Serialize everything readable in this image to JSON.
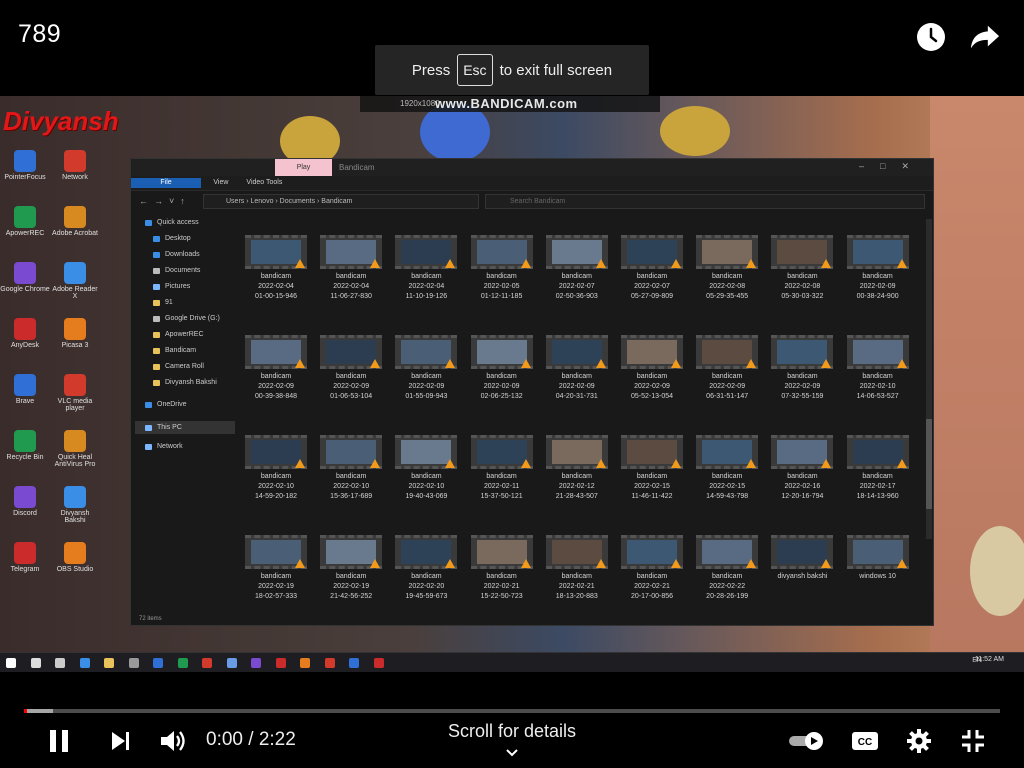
{
  "video_title": "789",
  "fullscreen_hint": {
    "prefix": "Press",
    "key": "Esc",
    "suffix": "to exit full screen"
  },
  "top_actions": [
    {
      "name": "watch-later-icon"
    },
    {
      "name": "share-icon"
    }
  ],
  "recording_overlay": {
    "watermark": "www.BANDICAM.com",
    "resolution": "1920x1080",
    "user_name": "Divyansh"
  },
  "desktop_icons": [
    "PointerFocus",
    "Network",
    "ApowerREC",
    "Adobe Acrobat",
    "Google Chrome",
    "Adobe Reader X",
    "AnyDesk",
    "Picasa 3",
    "Brave",
    "VLC media player",
    "Recycle Bin",
    "Quick Heal AntiVirus Pro",
    "Discord",
    "Divyansh Bakshi",
    "Telegram",
    "OBS Studio"
  ],
  "explorer": {
    "title": "Bandicam",
    "play_tab": "Play",
    "ribbon": [
      "File",
      "Home",
      "Share",
      "View",
      "Video Tools"
    ],
    "breadcrumb": "Users  ›  Lenovo  ›  Documents  ›  Bandicam",
    "search_placeholder": "Search Bandicam",
    "status": "72 items",
    "nav_items": [
      {
        "label": "Quick access",
        "color": "#3a8ee6"
      },
      {
        "label": "Desktop",
        "color": "#3a8ee6"
      },
      {
        "label": "Downloads",
        "color": "#3a8ee6"
      },
      {
        "label": "Documents",
        "color": "#bbbbbb"
      },
      {
        "label": "Pictures",
        "color": "#7ab7ff"
      },
      {
        "label": "91",
        "color": "#e8c25a"
      },
      {
        "label": "Google Drive (G:)",
        "color": "#bbbbbb"
      },
      {
        "label": "ApowerREC",
        "color": "#e8c25a"
      },
      {
        "label": "Bandicam",
        "color": "#e8c25a"
      },
      {
        "label": "Camera Roll",
        "color": "#e8c25a"
      },
      {
        "label": "Divyansh Bakshi",
        "color": "#e8c25a"
      },
      {
        "label": "OneDrive",
        "color": "#3a8ee6"
      },
      {
        "label": "This PC",
        "color": "#7ab7ff"
      },
      {
        "label": "Network",
        "color": "#7ab7ff"
      }
    ],
    "files": [
      {
        "name": "bandicam",
        "date": "2022-02-04",
        "time": "01-00-15-946"
      },
      {
        "name": "bandicam",
        "date": "2022-02-04",
        "time": "11-06-27-830"
      },
      {
        "name": "bandicam",
        "date": "2022-02-04",
        "time": "11-10-19-126"
      },
      {
        "name": "bandicam",
        "date": "2022-02-05",
        "time": "01-12-11-185"
      },
      {
        "name": "bandicam",
        "date": "2022-02-07",
        "time": "02-50-36-903"
      },
      {
        "name": "bandicam",
        "date": "2022-02-07",
        "time": "05-27-09-809"
      },
      {
        "name": "bandicam",
        "date": "2022-02-08",
        "time": "05-29-35-455"
      },
      {
        "name": "bandicam",
        "date": "2022-02-08",
        "time": "05-30-03-322"
      },
      {
        "name": "bandicam",
        "date": "2022-02-09",
        "time": "00-38-24-900"
      },
      {
        "name": "bandicam",
        "date": "2022-02-09",
        "time": "00-39-38-848"
      },
      {
        "name": "bandicam",
        "date": "2022-02-09",
        "time": "01-06-53-104"
      },
      {
        "name": "bandicam",
        "date": "2022-02-09",
        "time": "01-55-09-943"
      },
      {
        "name": "bandicam",
        "date": "2022-02-09",
        "time": "02-06-25-132"
      },
      {
        "name": "bandicam",
        "date": "2022-02-09",
        "time": "04-20-31-731"
      },
      {
        "name": "bandicam",
        "date": "2022-02-09",
        "time": "05-52-13-054"
      },
      {
        "name": "bandicam",
        "date": "2022-02-09",
        "time": "06-31-51-147"
      },
      {
        "name": "bandicam",
        "date": "2022-02-09",
        "time": "07-32-55-159"
      },
      {
        "name": "bandicam",
        "date": "2022-02-10",
        "time": "14-06-53-527"
      },
      {
        "name": "bandicam",
        "date": "2022-02-10",
        "time": "14-59-20-182"
      },
      {
        "name": "bandicam",
        "date": "2022-02-10",
        "time": "15-36-17-689"
      },
      {
        "name": "bandicam",
        "date": "2022-02-10",
        "time": "19-40-43-069"
      },
      {
        "name": "bandicam",
        "date": "2022-02-11",
        "time": "15-37-50-121"
      },
      {
        "name": "bandicam",
        "date": "2022-02-12",
        "time": "21-28-43-507"
      },
      {
        "name": "bandicam",
        "date": "2022-02-15",
        "time": "11-46-11-422"
      },
      {
        "name": "bandicam",
        "date": "2022-02-15",
        "time": "14-59-43-798"
      },
      {
        "name": "bandicam",
        "date": "2022-02-16",
        "time": "12-20-16-794"
      },
      {
        "name": "bandicam",
        "date": "2022-02-17",
        "time": "18-14-13-960"
      },
      {
        "name": "bandicam",
        "date": "2022-02-19",
        "time": "18-02-57-333"
      },
      {
        "name": "bandicam",
        "date": "2022-02-19",
        "time": "21-42-56-252"
      },
      {
        "name": "bandicam",
        "date": "2022-02-20",
        "time": "19-45-59-673"
      },
      {
        "name": "bandicam",
        "date": "2022-02-21",
        "time": "15-22-50-723"
      },
      {
        "name": "bandicam",
        "date": "2022-02-21",
        "time": "18-13-20-883"
      },
      {
        "name": "bandicam",
        "date": "2022-02-21",
        "time": "20-17-00-856"
      },
      {
        "name": "bandicam",
        "date": "2022-02-22",
        "time": "20-28-26-199"
      },
      {
        "name": "divyansh bakshi",
        "date": "",
        "time": ""
      },
      {
        "name": "windows 10",
        "date": "",
        "time": ""
      }
    ],
    "taskbar_clock": "11:52 AM",
    "taskbar_lang": "EN"
  },
  "player": {
    "time_display": "0:00 / 2:22",
    "scroll_hint": "Scroll for details",
    "played_fraction": 0.003,
    "loaded_fraction": 0.03,
    "accent": "#ff0000",
    "controls_left": [
      "pause-icon",
      "next-icon",
      "volume-icon"
    ],
    "controls_right": [
      "autoplay-toggle-icon",
      "captions-icon",
      "settings-icon",
      "exit-fullscreen-icon"
    ]
  }
}
